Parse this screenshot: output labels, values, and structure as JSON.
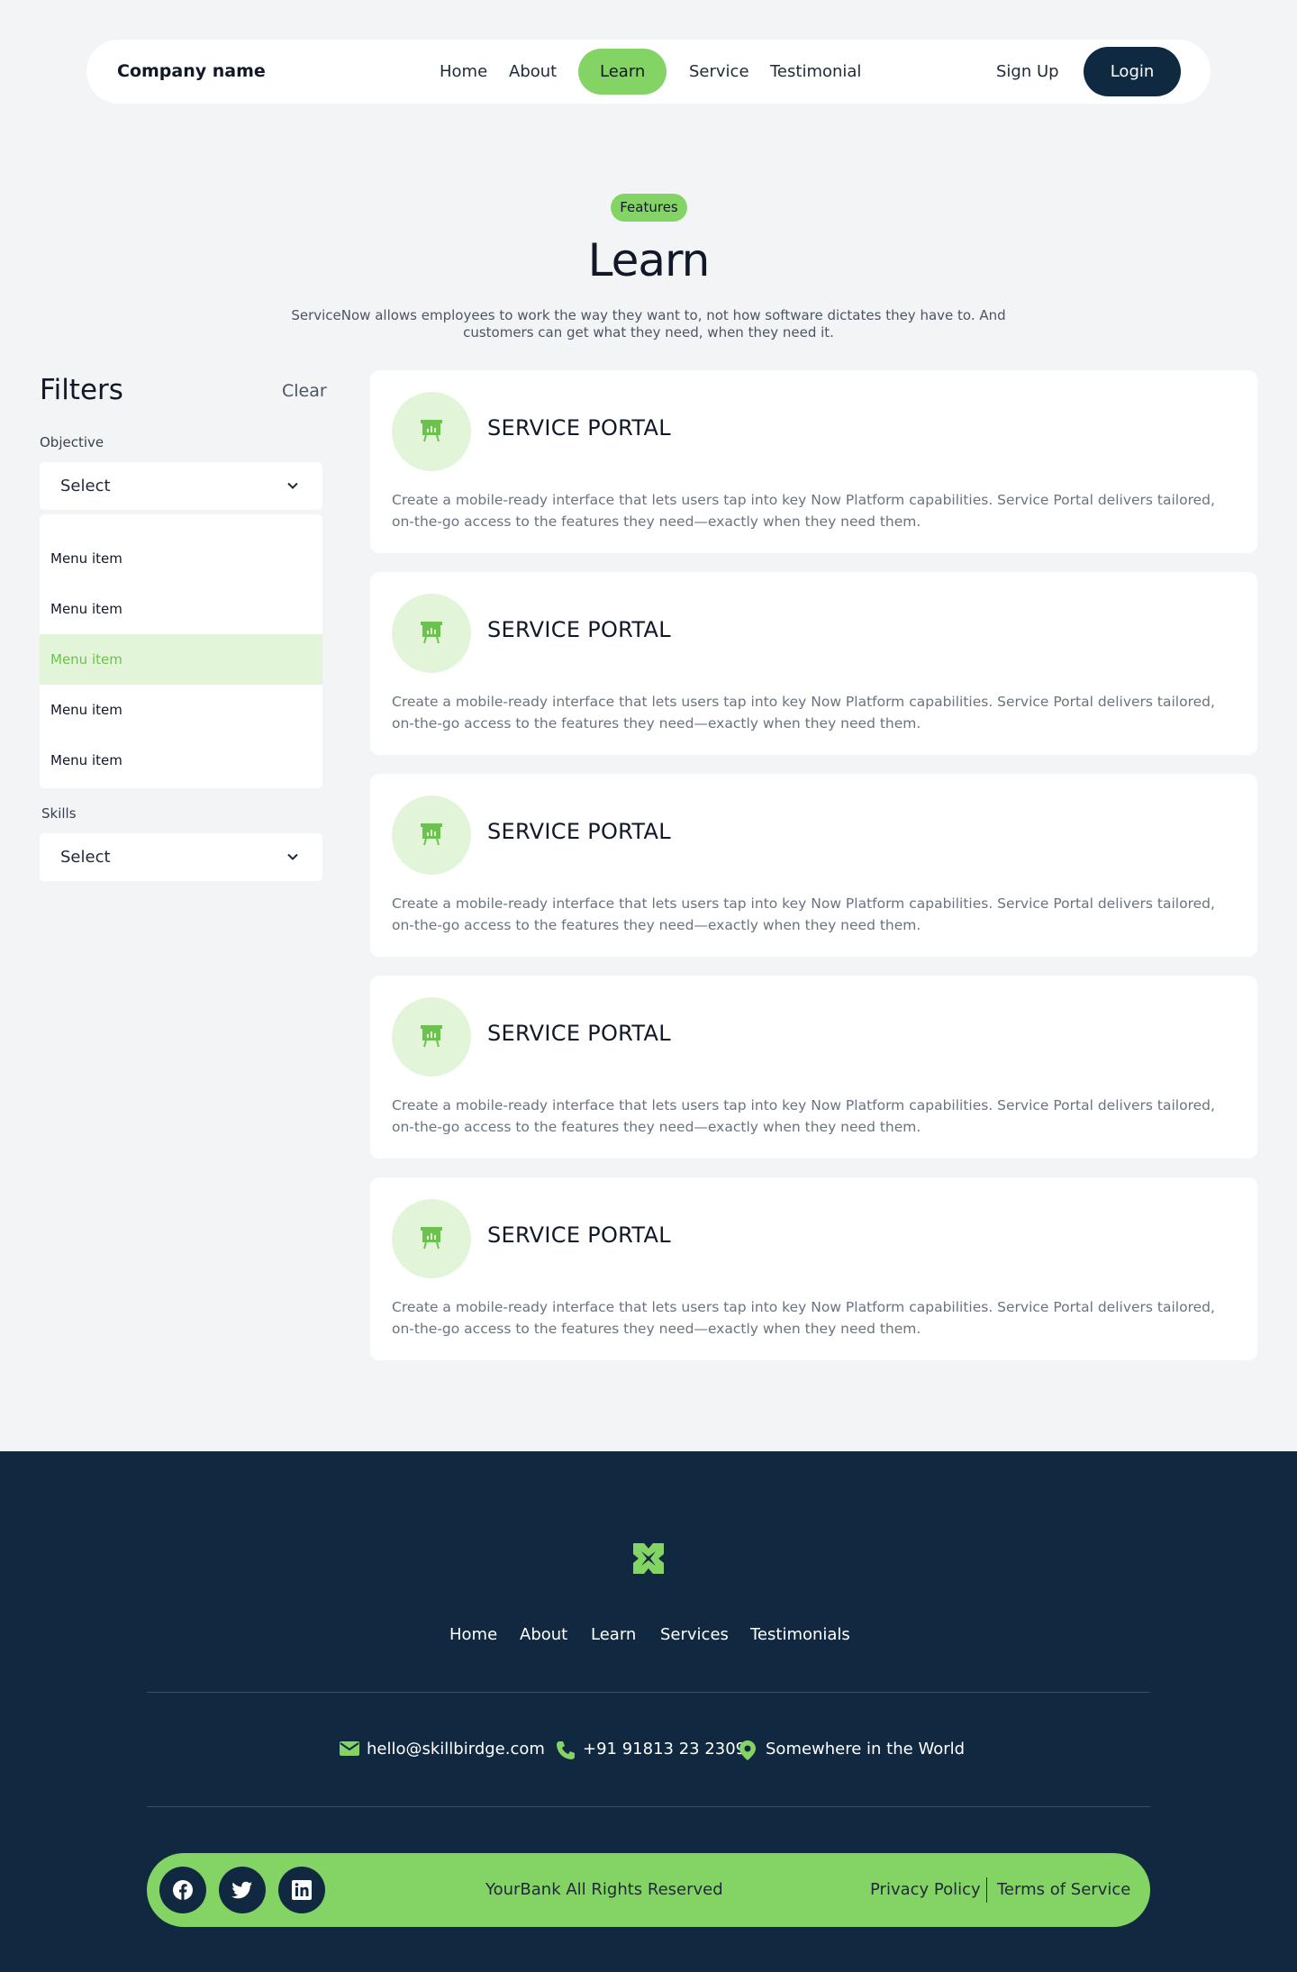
{
  "nav": {
    "brand": "Company name",
    "links": [
      "Home",
      "About",
      "Learn",
      "Service",
      "Testimonial"
    ],
    "active": "Learn",
    "signup": "Sign Up",
    "login": "Login"
  },
  "hero": {
    "badge": "Features",
    "title": "Learn",
    "subtitle": "ServiceNow allows employees to work the way they want to, not how software dictates they have to. And customers can get what they need, when they need it."
  },
  "filters": {
    "title": "Filters",
    "clear": "Clear",
    "objective_label": "Objective",
    "objective_value": "Select",
    "menu_items": [
      "Menu item",
      "Menu item",
      "Menu item",
      "Menu item",
      "Menu item"
    ],
    "menu_active_index": 2,
    "skills_label": "Skills",
    "skills_value": "Select"
  },
  "cards": [
    {
      "title": "SERVICE PORTAL",
      "description": "Create a mobile-ready interface that lets users tap into key Now Platform capabilities. Service Portal delivers tailored, on-the-go access to the features they need—exactly when they need them."
    },
    {
      "title": "SERVICE PORTAL",
      "description": "Create a mobile-ready interface that lets users tap into key Now Platform capabilities. Service Portal delivers tailored, on-the-go access to the features they need—exactly when they need them."
    },
    {
      "title": "SERVICE PORTAL",
      "description": "Create a mobile-ready interface that lets users tap into key Now Platform capabilities. Service Portal delivers tailored, on-the-go access to the features they need—exactly when they need them."
    },
    {
      "title": "SERVICE PORTAL",
      "description": "Create a mobile-ready interface that lets users tap into key Now Platform capabilities. Service Portal delivers tailored, on-the-go access to the features they need—exactly when they need them."
    },
    {
      "title": "SERVICE PORTAL",
      "description": "Create a mobile-ready interface that lets users tap into key Now Platform capabilities. Service Portal delivers tailored, on-the-go access to the features they need—exactly when they need them."
    }
  ],
  "footer": {
    "links": [
      "Home",
      "About",
      "Learn",
      "Services",
      "Testimonials"
    ],
    "email": "hello@skillbirdge.com",
    "phone": "+91 91813 23 2309",
    "location": "Somewhere in the World",
    "rights": "YourBank All Rights Reserved",
    "privacy": "Privacy Policy",
    "terms": "Terms of Service",
    "social": [
      "facebook-icon",
      "twitter-icon",
      "linkedin-icon"
    ]
  },
  "colors": {
    "accent": "#84d465",
    "accent_light": "#e2f5d9",
    "dark": "#102940",
    "background": "#f3f4f6"
  }
}
